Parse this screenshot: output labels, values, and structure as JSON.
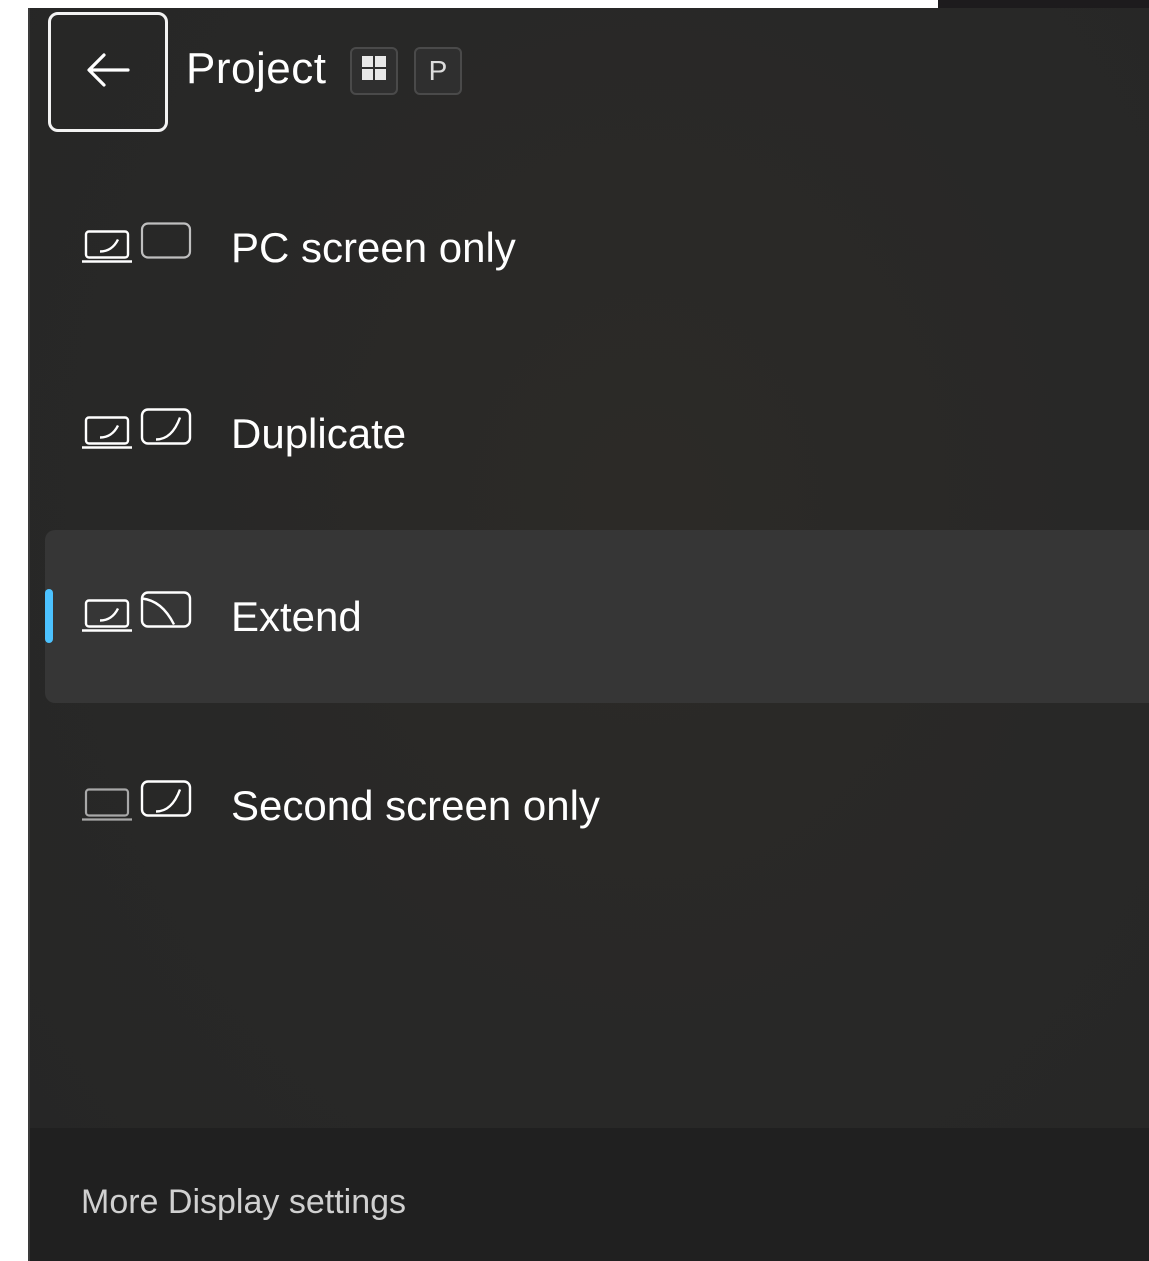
{
  "header": {
    "title": "Project",
    "back_icon": "arrow-left-icon",
    "shortcut": {
      "win_key_icon": "windows-logo-icon",
      "letter": "P"
    }
  },
  "options": [
    {
      "label": "PC screen only",
      "icon": "pc-screen-only-icon",
      "selected": false
    },
    {
      "label": "Duplicate",
      "icon": "duplicate-icon",
      "selected": false
    },
    {
      "label": "Extend",
      "icon": "extend-icon",
      "selected": true
    },
    {
      "label": "Second screen only",
      "icon": "second-screen-only-icon",
      "selected": false
    }
  ],
  "footer": {
    "link_label": "More Display settings"
  },
  "colors": {
    "accent": "#4cc2ff",
    "panel": "#272727",
    "selected": "#363636",
    "footer": "#202020"
  }
}
